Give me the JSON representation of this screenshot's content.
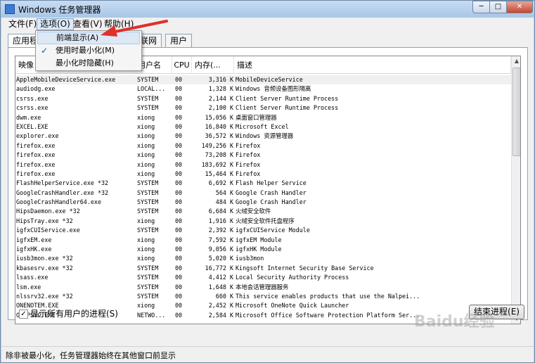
{
  "window": {
    "title": "Windows 任务管理器"
  },
  "caption_buttons": {
    "min": "─",
    "max": "□",
    "close": "✕"
  },
  "menu": {
    "file": "文件(F)",
    "options": "选项(O)",
    "view": "查看(V)",
    "help": "帮助(H)"
  },
  "options_menu": {
    "items": [
      "前端显示(A)",
      "使用时最小化(M)",
      "最小化时隐藏(H)"
    ],
    "checked_index": 1,
    "check_glyph": "✓"
  },
  "tabs": {
    "apps": "应用程",
    "network": "联网",
    "users": "用户"
  },
  "columns": {
    "image": "映像",
    "user": "用户名",
    "cpu": "CPU",
    "mem": "内存(...",
    "desc": "描述"
  },
  "processes": [
    {
      "image": "AppleMobileDeviceService.exe",
      "user": "SYSTEM",
      "cpu": "00",
      "mem": "3,316 K",
      "desc": "MobileDeviceService"
    },
    {
      "image": "audiodg.exe",
      "user": "LOCAL...",
      "cpu": "00",
      "mem": "1,328 K",
      "desc": "Windows 音频设备图形隔离"
    },
    {
      "image": "csrss.exe",
      "user": "SYSTEM",
      "cpu": "00",
      "mem": "2,144 K",
      "desc": "Client Server Runtime Process"
    },
    {
      "image": "csrss.exe",
      "user": "SYSTEM",
      "cpu": "00",
      "mem": "2,100 K",
      "desc": "Client Server Runtime Process"
    },
    {
      "image": "dwm.exe",
      "user": "xiong",
      "cpu": "00",
      "mem": "15,056 K",
      "desc": "桌面窗口管理器"
    },
    {
      "image": "EXCEL.EXE",
      "user": "xiong",
      "cpu": "00",
      "mem": "16,840 K",
      "desc": "Microsoft Excel"
    },
    {
      "image": "explorer.exe",
      "user": "xiong",
      "cpu": "00",
      "mem": "36,572 K",
      "desc": "Windows 资源管理器"
    },
    {
      "image": "firefox.exe",
      "user": "xiong",
      "cpu": "00",
      "mem": "149,256 K",
      "desc": "Firefox"
    },
    {
      "image": "firefox.exe",
      "user": "xiong",
      "cpu": "00",
      "mem": "73,208 K",
      "desc": "Firefox"
    },
    {
      "image": "firefox.exe",
      "user": "xiong",
      "cpu": "00",
      "mem": "183,692 K",
      "desc": "Firefox"
    },
    {
      "image": "firefox.exe",
      "user": "xiong",
      "cpu": "00",
      "mem": "15,464 K",
      "desc": "Firefox"
    },
    {
      "image": "FlashHelperService.exe *32",
      "user": "SYSTEM",
      "cpu": "00",
      "mem": "6,692 K",
      "desc": "Flash Helper Service"
    },
    {
      "image": "GoogleCrashHandler.exe *32",
      "user": "SYSTEM",
      "cpu": "00",
      "mem": "564 K",
      "desc": "Google Crash Handler"
    },
    {
      "image": "GoogleCrashHandler64.exe",
      "user": "SYSTEM",
      "cpu": "00",
      "mem": "484 K",
      "desc": "Google Crash Handler"
    },
    {
      "image": "HipsDaemon.exe *32",
      "user": "SYSTEM",
      "cpu": "00",
      "mem": "6,684 K",
      "desc": "火绒安全软件"
    },
    {
      "image": "HipsTray.exe *32",
      "user": "xiong",
      "cpu": "00",
      "mem": "1,916 K",
      "desc": "火绒安全软件托盘程序"
    },
    {
      "image": "igfxCUIService.exe",
      "user": "SYSTEM",
      "cpu": "00",
      "mem": "2,392 K",
      "desc": "igfxCUIService Module"
    },
    {
      "image": "igfxEM.exe",
      "user": "xiong",
      "cpu": "00",
      "mem": "7,592 K",
      "desc": "igfxEM Module"
    },
    {
      "image": "igfxHK.exe",
      "user": "xiong",
      "cpu": "00",
      "mem": "9,056 K",
      "desc": "igfxHK Module"
    },
    {
      "image": "iusb3mon.exe *32",
      "user": "xiong",
      "cpu": "00",
      "mem": "5,020 K",
      "desc": "iusb3mon"
    },
    {
      "image": "kbasesrv.exe *32",
      "user": "SYSTEM",
      "cpu": "00",
      "mem": "16,772 K",
      "desc": "Kingsoft Internet Security Base Service"
    },
    {
      "image": "lsass.exe",
      "user": "SYSTEM",
      "cpu": "00",
      "mem": "4,412 K",
      "desc": "Local Security Authority Process"
    },
    {
      "image": "lsm.exe",
      "user": "SYSTEM",
      "cpu": "00",
      "mem": "1,648 K",
      "desc": "本地会话管理器服务"
    },
    {
      "image": "nlssrv32.exe *32",
      "user": "SYSTEM",
      "cpu": "00",
      "mem": "660 K",
      "desc": "This service enables products that use the Nalpei..."
    },
    {
      "image": "ONENOTEM.EXE",
      "user": "xiong",
      "cpu": "00",
      "mem": "2,452 K",
      "desc": "Microsoft OneNote Quick Launcher"
    },
    {
      "image": "OSPPSVC.EXE",
      "user": "NETWO...",
      "cpu": "00",
      "mem": "2,584 K",
      "desc": "Microsoft Office Software Protection Platform Ser..."
    }
  ],
  "show_all_users": {
    "label": "显示所有用户的进程(S)",
    "checked": true,
    "check_glyph": "✓"
  },
  "end_process_button": "结束进程(E)",
  "status": "除非被最小化，任务管理器始终在其他窗口前显示",
  "watermark": "Baidu经验",
  "colors": {
    "arrow": "#e0302a",
    "title_bar": "#bcd3ec",
    "checkmark": "#1f4a9a"
  }
}
